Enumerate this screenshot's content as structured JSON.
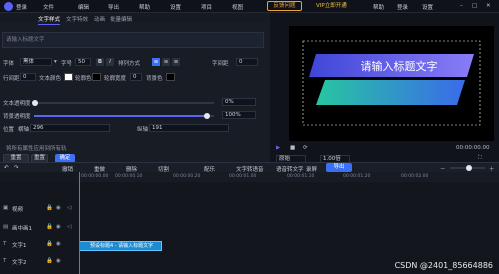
{
  "topbar": {
    "menu": [
      "登录",
      "文件",
      "编辑",
      "导出",
      "帮助",
      "设置",
      "项目",
      "视图"
    ],
    "feedback": "反馈问题",
    "vip": "VIP立即开通",
    "right_items": [
      "帮助",
      "登录",
      "设置"
    ]
  },
  "editor_tabs": [
    "文字样式",
    "文字特效",
    "动画",
    "批量编辑"
  ],
  "text_input_placeholder": "请输入标题文字",
  "font": {
    "label": "字体",
    "value": "黑体",
    "size_label": "字号",
    "size": "50",
    "spacing_label": "字间距",
    "spacing": "0",
    "line_label": "行间距",
    "line": "0",
    "color_label": "文本颜色",
    "border_label": "轮廓色",
    "border_width_label": "轮廓宽度",
    "border_width": "0",
    "bg_label": "背景色"
  },
  "sliders": {
    "opacity_label": "文本透明度",
    "opacity": "0%",
    "bg_opacity_label": "背景透明度",
    "bg_opacity": "100%",
    "pos_label": "位置",
    "x_label": "横轴",
    "x": "296",
    "y_label": "纵轴",
    "y": "191"
  },
  "apply_all": "将所有属性应用到所有轨",
  "buttons": {
    "reset": "重置",
    "ok": "确定",
    "export": "导出"
  },
  "preview_title": "请输入标题文字",
  "preview_bottom": {
    "ratio": "原始",
    "speed": "1.00倍",
    "time": "00:00:00.00"
  },
  "timeline_toolbar": [
    "撤销",
    "重做",
    "删除",
    "切割",
    "配乐",
    "文字转语音",
    "语音转文字",
    "录屏"
  ],
  "ruler": [
    "00:00:00.00",
    "00:00:00.10",
    "00:00:00.20",
    "00:00:01.00",
    "00:00:01.10",
    "00:00:01.20",
    "00:00:02.00"
  ],
  "tracks": [
    "视频",
    "画中画1",
    "文字1",
    "文字2"
  ],
  "clip_label": "预设标题4 - 请输入标题文字",
  "cover_label": "封面",
  "watermark": "CSDN @2401_85664886",
  "colors": {
    "accent": "#5d62f5",
    "banner_top": "#7a7cf5",
    "banner_bottom": "#2ec5b0",
    "clip": "#1d8bd1"
  }
}
